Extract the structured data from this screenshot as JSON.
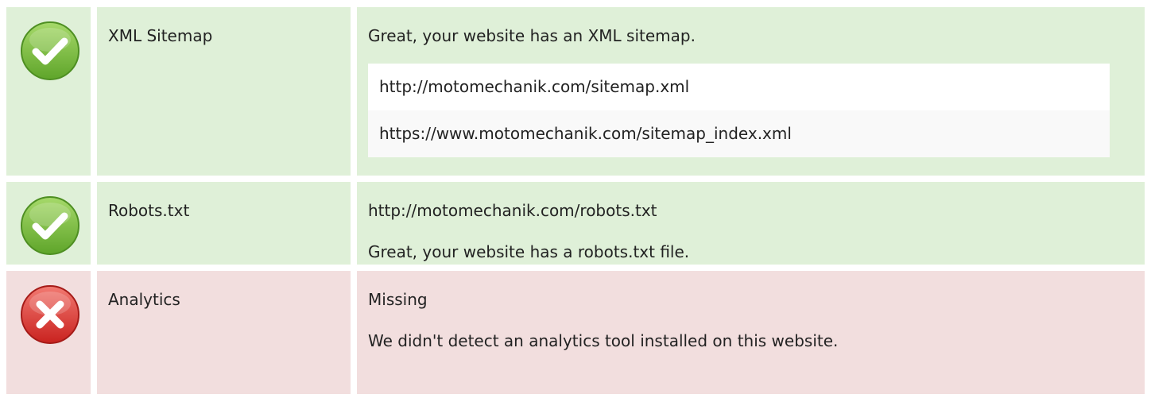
{
  "colors": {
    "pass_background": "#dff0d8",
    "fail_background": "#f2dede",
    "pass_icon": "#7cbf3a",
    "fail_icon": "#e0393a"
  },
  "checks": [
    {
      "status": "pass",
      "icon": "check-circle-icon",
      "name": "XML Sitemap",
      "message": "Great, your website has an XML sitemap.",
      "urls": [
        "http://motomechanik.com/sitemap.xml",
        "https://www.motomechanik.com/sitemap_index.xml"
      ]
    },
    {
      "status": "pass",
      "icon": "check-circle-icon",
      "name": "Robots.txt",
      "url": "http://motomechanik.com/robots.txt",
      "message": "Great, your website has a robots.txt file."
    },
    {
      "status": "fail",
      "icon": "cross-circle-icon",
      "name": "Analytics",
      "value": "Missing",
      "message": "We didn't detect an analytics tool installed on this website."
    }
  ]
}
